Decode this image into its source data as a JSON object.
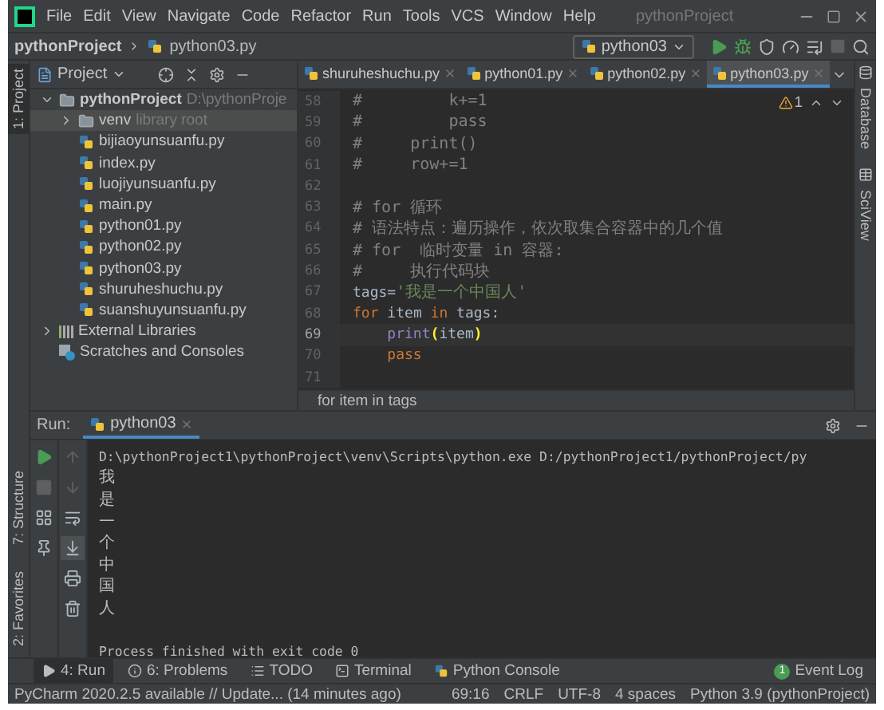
{
  "title_bar": {
    "menu": [
      "File",
      "Edit",
      "View",
      "Navigate",
      "Code",
      "Refactor",
      "Run",
      "Tools",
      "VCS",
      "Window",
      "Help"
    ],
    "title": "pythonProject"
  },
  "nav_bar": {
    "project": "pythonProject",
    "file": "python03.py",
    "run_config": "python03"
  },
  "left_stripe": {
    "top": [
      {
        "label": "1: Project",
        "selected": true
      }
    ],
    "bottom": [
      {
        "label": "7: Structure",
        "selected": false
      },
      {
        "label": "2: Favorites",
        "selected": false
      }
    ]
  },
  "project_panel": {
    "title": "Project",
    "tree": [
      {
        "name": "pythonProject",
        "kind": "folder",
        "note": "D:\\pythonProje",
        "expanded": true,
        "selected": false,
        "children": [
          {
            "name": "venv",
            "kind": "folder",
            "note": "library root",
            "expanded": false,
            "selected": true
          },
          {
            "name": "bijiaoyunsuanfu.py",
            "kind": "file",
            "selected": false
          },
          {
            "name": "index.py",
            "kind": "file",
            "selected": false
          },
          {
            "name": "luojiyunsuanfu.py",
            "kind": "file",
            "selected": false
          },
          {
            "name": "main.py",
            "kind": "file",
            "selected": false
          },
          {
            "name": "python01.py",
            "kind": "file",
            "selected": false
          },
          {
            "name": "python02.py",
            "kind": "file",
            "selected": false
          },
          {
            "name": "python03.py",
            "kind": "file",
            "selected": false
          },
          {
            "name": "shuruheshuchu.py",
            "kind": "file",
            "selected": false
          },
          {
            "name": "suanshuyunsuanfu.py",
            "kind": "file",
            "selected": false
          }
        ]
      },
      {
        "name": "External Libraries",
        "kind": "libraries",
        "expanded": false,
        "selected": false
      },
      {
        "name": "Scratches and Consoles",
        "kind": "scratches",
        "selected": false
      }
    ]
  },
  "editor": {
    "tabs": [
      {
        "label": "shuruheshuchu.py",
        "selected": false
      },
      {
        "label": "python01.py",
        "selected": false
      },
      {
        "label": "python02.py",
        "selected": false
      },
      {
        "label": "python03.py",
        "selected": true
      }
    ],
    "inspection": "1",
    "lines": [
      {
        "number": "58",
        "current": false,
        "tokens": [
          {
            "text": "#         k+=1",
            "kind": "comment"
          }
        ]
      },
      {
        "number": "59",
        "current": false,
        "tokens": [
          {
            "text": "#         pass",
            "kind": "comment"
          }
        ]
      },
      {
        "number": "60",
        "current": false,
        "tokens": [
          {
            "text": "#     print()",
            "kind": "comment"
          }
        ]
      },
      {
        "number": "61",
        "current": false,
        "tokens": [
          {
            "text": "#     row+=1",
            "kind": "comment"
          }
        ]
      },
      {
        "number": "62",
        "current": false
      },
      {
        "number": "63",
        "current": false,
        "tokens": [
          {
            "text": "# for 循环",
            "kind": "comment"
          }
        ]
      },
      {
        "number": "64",
        "current": false,
        "tokens": [
          {
            "text": "# 语法特点：遍历操作，依次取集合容器中的几个值",
            "kind": "comment"
          }
        ]
      },
      {
        "number": "65",
        "current": false,
        "tokens": [
          {
            "text": "# for  临时变量 in 容器:",
            "kind": "comment"
          }
        ]
      },
      {
        "number": "66",
        "current": false,
        "tokens": [
          {
            "text": "#     执行代码块",
            "kind": "comment"
          }
        ]
      },
      {
        "number": "67",
        "current": false,
        "tokens": [
          {
            "text": "tags=",
            "kind": "plain"
          },
          {
            "text": "'我是一个中国人'",
            "kind": "string"
          }
        ]
      },
      {
        "number": "68",
        "current": false,
        "tokens": [
          {
            "text": "for",
            "kind": "keyword"
          },
          {
            "text": " item ",
            "kind": "plain"
          },
          {
            "text": "in",
            "kind": "keyword"
          },
          {
            "text": " tags:",
            "kind": "plain"
          }
        ]
      },
      {
        "number": "69",
        "current": true,
        "tokens": [
          {
            "text": "    print",
            "kind": "builtin"
          },
          {
            "text": "(",
            "kind": "match"
          },
          {
            "text": "item",
            "kind": "plain"
          },
          {
            "text": ")",
            "kind": "match"
          }
        ]
      },
      {
        "number": "70",
        "current": false,
        "tokens": [
          {
            "text": "    pass",
            "kind": "keyword"
          }
        ]
      },
      {
        "number": "71",
        "current": false
      }
    ],
    "breadcrumb": "for item in tags"
  },
  "right_stripe": [
    {
      "label": "Database"
    },
    {
      "label": "SciView"
    }
  ],
  "run_panel": {
    "label": "Run:",
    "tab": "python03",
    "tools_left": [
      {
        "kind": "run",
        "disabled": false
      },
      {
        "kind": "stop",
        "disabled": true
      },
      {
        "kind": "layout",
        "disabled": false
      },
      {
        "kind": "pin",
        "disabled": false
      }
    ],
    "tools_right": [
      {
        "kind": "up",
        "disabled": true,
        "on": false
      },
      {
        "kind": "down",
        "disabled": true,
        "on": false
      },
      {
        "kind": "wrap",
        "disabled": false,
        "on": false
      },
      {
        "kind": "scroll",
        "disabled": false,
        "on": true
      },
      {
        "kind": "print",
        "disabled": false,
        "on": false
      },
      {
        "kind": "trash",
        "disabled": false,
        "on": false
      }
    ],
    "console": [
      "D:\\pythonProject1\\pythonProject\\venv\\Scripts\\python.exe D:/pythonProject1/pythonProject/py",
      "我",
      "是",
      "一",
      "个",
      "中",
      "国",
      "人"
    ],
    "exit_message": "Process finished with exit code 0"
  },
  "tool_strip": [
    {
      "label": "4: Run",
      "kind": "run",
      "selected": true
    },
    {
      "label": "6: Problems",
      "kind": "problems",
      "selected": false
    },
    {
      "label": "TODO",
      "kind": "todo",
      "selected": false
    },
    {
      "label": "Terminal",
      "kind": "terminal",
      "selected": false
    },
    {
      "label": "Python Console",
      "kind": "console",
      "selected": false
    }
  ],
  "event_log": {
    "label": "Event Log",
    "count": "1"
  },
  "status_bar": {
    "message": "PyCharm 2020.2.5 available // Update... (14 minutes ago)",
    "items": [
      "69:16",
      "CRLF",
      "UTF-8",
      "4 spaces",
      "Python 3.9 (pythonProject)"
    ]
  }
}
